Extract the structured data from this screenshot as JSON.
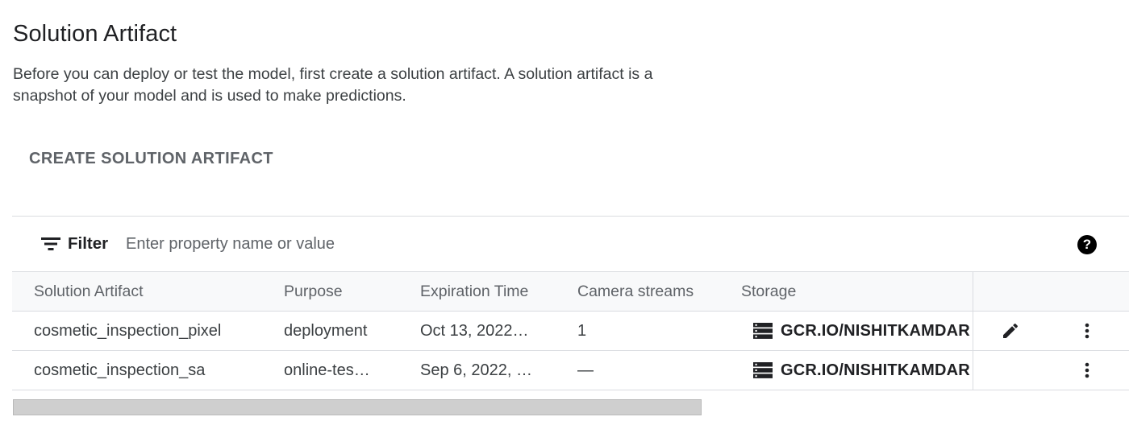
{
  "page": {
    "title": "Solution Artifact",
    "description": "Before you can deploy or test the model, first create a solution artifact. A solution artifact is a snapshot of your model and is used to make predictions.",
    "create_button_label": "CREATE SOLUTION ARTIFACT"
  },
  "filter": {
    "label": "Filter",
    "placeholder": "Enter property name or value",
    "icon": "filter-list-icon",
    "help_icon": "help-icon"
  },
  "table": {
    "columns": [
      "Solution Artifact",
      "Purpose",
      "Expiration Time",
      "Camera streams",
      "Storage"
    ],
    "rows": [
      {
        "name": "cosmetic_inspection_pixel",
        "purpose": "deployment",
        "expiration": "Oct 13, 2022…",
        "camera_streams": "1",
        "storage": "GCR.IO/NISHITKAMDAR",
        "has_edit": true
      },
      {
        "name": "cosmetic_inspection_sa",
        "purpose": "online-tes…",
        "expiration": "Sep 6, 2022, …",
        "camera_streams": "—",
        "storage": "GCR.IO/NISHITKAMDAR",
        "has_edit": false
      }
    ]
  },
  "colors": {
    "text_primary": "#202124",
    "text_secondary": "#5f6368",
    "border": "#dadce0"
  }
}
